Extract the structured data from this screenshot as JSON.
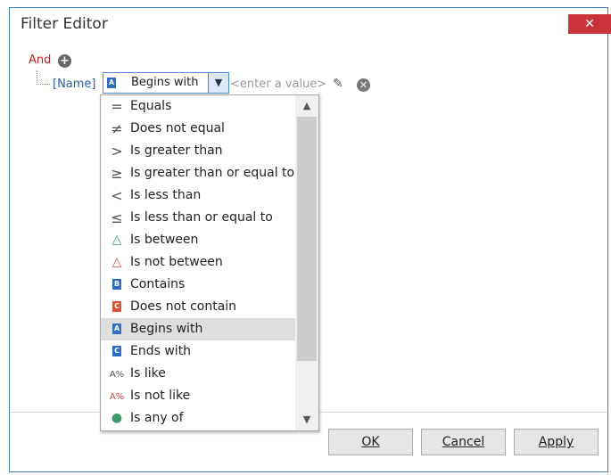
{
  "window": {
    "title": "Filter Editor",
    "close_glyph": "✕"
  },
  "filter": {
    "group_operator": "And",
    "add_glyph": "+",
    "field": "[Name]",
    "operator": "Begins with",
    "value_placeholder": "<enter a value>",
    "remove_glyph": "✕"
  },
  "operators": [
    {
      "label": "Equals",
      "icon": "equals-icon"
    },
    {
      "label": "Does not equal",
      "icon": "not-equal-icon"
    },
    {
      "label": "Is greater than",
      "icon": "greater-than-icon"
    },
    {
      "label": "Is greater than or equal to",
      "icon": "greater-equal-icon"
    },
    {
      "label": "Is less than",
      "icon": "less-than-icon"
    },
    {
      "label": "Is less than or equal to",
      "icon": "less-equal-icon"
    },
    {
      "label": "Is between",
      "icon": "between-icon"
    },
    {
      "label": "Is not between",
      "icon": "not-between-icon"
    },
    {
      "label": "Contains",
      "icon": "contains-icon"
    },
    {
      "label": "Does not contain",
      "icon": "does-not-contain-icon"
    },
    {
      "label": "Begins with",
      "icon": "begins-with-icon",
      "selected": true
    },
    {
      "label": "Ends with",
      "icon": "ends-with-icon"
    },
    {
      "label": "Is like",
      "icon": "is-like-icon"
    },
    {
      "label": "Is not like",
      "icon": "is-not-like-icon"
    },
    {
      "label": "Is any of",
      "icon": "is-any-of-icon"
    }
  ],
  "buttons": {
    "ok": "OK",
    "cancel": "Cancel",
    "apply": "Apply"
  },
  "colors": {
    "accent": "#3c7ec0",
    "close": "#c9333a",
    "group_operator": "#c41e1e",
    "field": "#2a5db0"
  }
}
